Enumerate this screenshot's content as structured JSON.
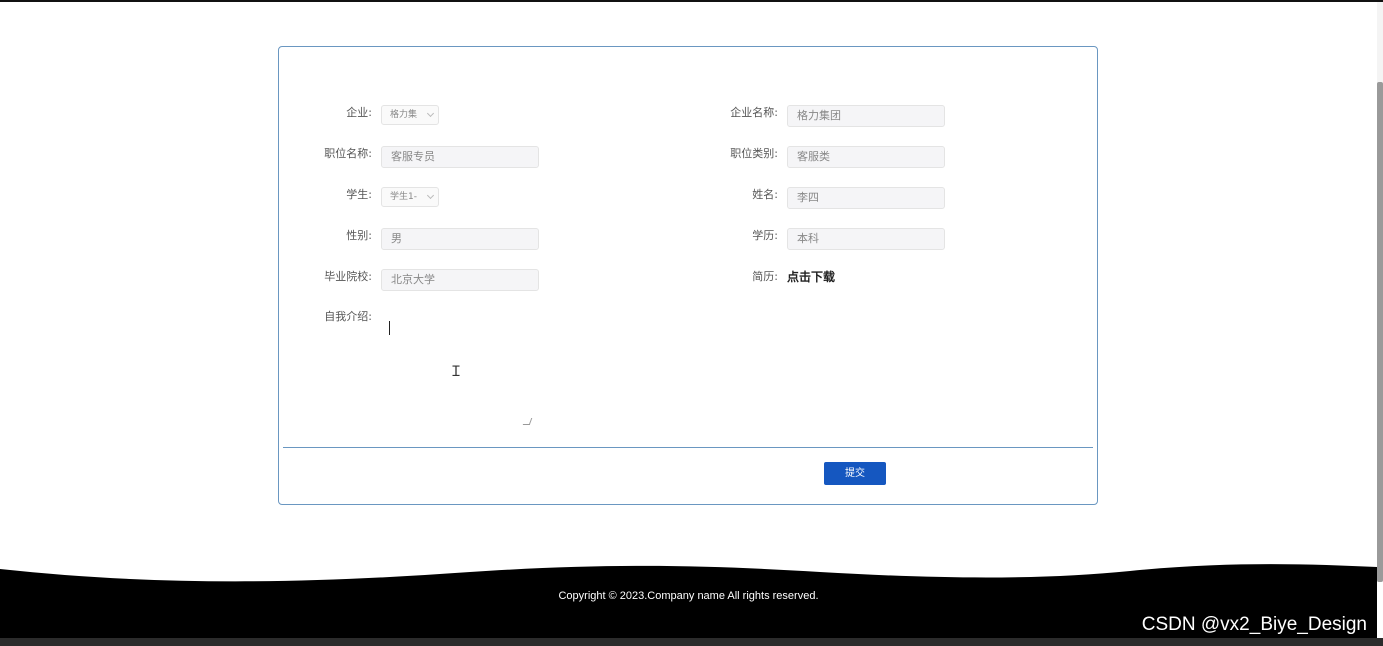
{
  "form": {
    "company_label": "企业:",
    "company_select_value": "格力集",
    "company_name_label": "企业名称:",
    "company_name_value": "格力集团",
    "position_name_label": "职位名称:",
    "position_name_value": "客服专员",
    "position_type_label": "职位类别:",
    "position_type_value": "客服类",
    "student_label": "学生:",
    "student_select_value": "学生1-",
    "name_label": "姓名:",
    "name_value": "李四",
    "gender_label": "性别:",
    "gender_value": "男",
    "education_label": "学历:",
    "education_value": "本科",
    "school_label": "毕业院校:",
    "school_value": "北京大学",
    "resume_label": "简历:",
    "resume_link": "点击下载",
    "intro_label": "自我介绍:",
    "intro_value": "",
    "submit_label": "提交"
  },
  "footer": {
    "copyright": "Copyright © 2023.Company name All rights reserved."
  },
  "watermark": "CSDN @vx2_Biye_Design",
  "colors": {
    "panel_border": "#6a97c1",
    "submit_bg": "#1557c0",
    "footer_bg": "#000000"
  }
}
